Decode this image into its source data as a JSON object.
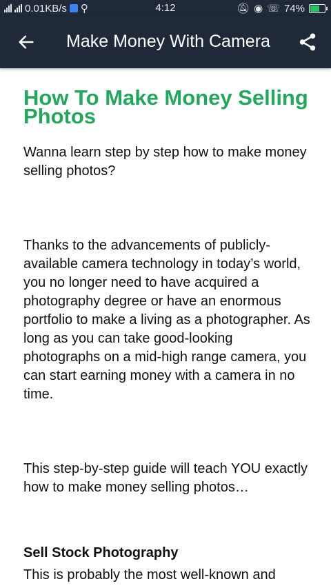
{
  "status": {
    "network": "0.01KB/s",
    "time": "4:12",
    "battery": "74%",
    "battery_level": 0.74
  },
  "appbar": {
    "title": "Make Money With Camera",
    "back_icon": "arrow-left-icon",
    "share_icon": "share-icon"
  },
  "article": {
    "heading": "How To Make Money Selling Photos",
    "intro": "Wanna learn step by step how to make money selling photos?",
    "para1": "Thanks to the advancements of publicly-available camera technology in today’s world, you no longer need to have acquired a photography degree or have an enormous portfolio to make a living as a photographer. As long as you can take good-looking photographs on a mid-high range camera, you can start earning money with a camera in no time.",
    "para2": "This step-by-step guide will teach YOU exactly how to make money selling photos…",
    "subheading": "Sell Stock Photography",
    "para3": "This is probably the most well-known and"
  },
  "colors": {
    "appbar": "#1f2937",
    "heading": "#22a85a"
  }
}
